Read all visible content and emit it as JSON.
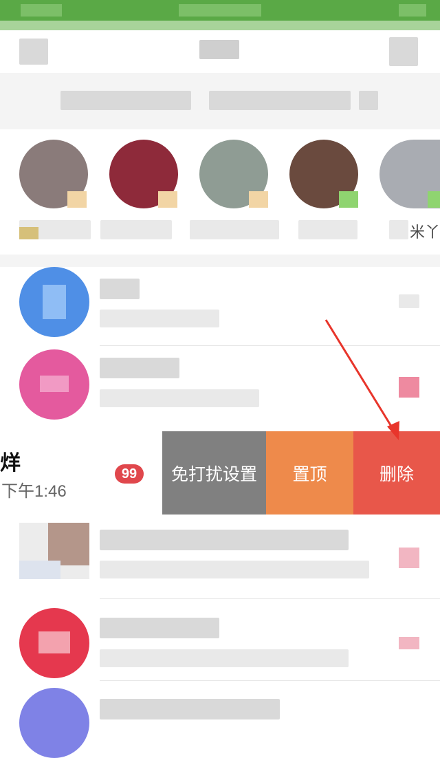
{
  "stories": {
    "visible_name": "米丫"
  },
  "swiped_row": {
    "title": "烊",
    "time": "下午1:46",
    "unread": "99",
    "actions": {
      "mute_label": "免打扰设置",
      "pin_label": "置顶",
      "delete_label": "删除"
    }
  },
  "colors": {
    "status_bar": "#5aa946",
    "mute_button": "#808080",
    "pin_button": "#ee8a4b",
    "delete_button": "#e8574a",
    "badge": "#e0474c",
    "annotation_arrow": "#e8352b"
  }
}
